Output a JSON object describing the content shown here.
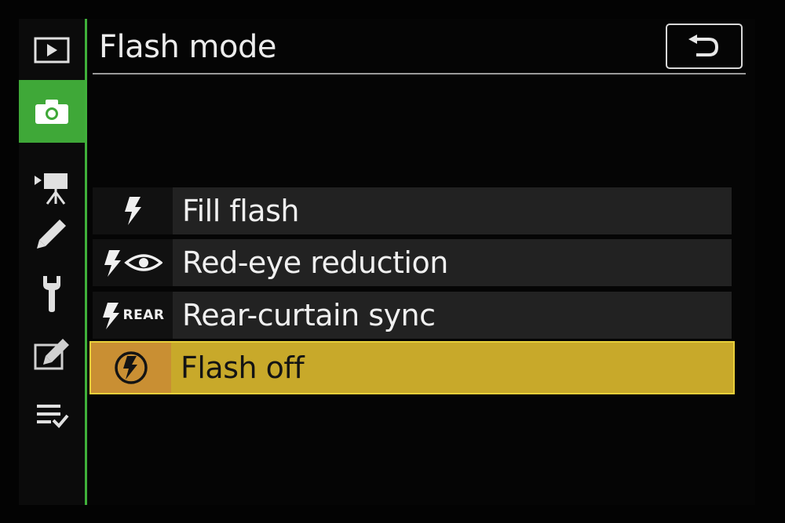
{
  "header": {
    "title": "Flash mode",
    "back_button_icon": "return-arrow-icon"
  },
  "sidebar": {
    "items": [
      {
        "icon": "playback-icon",
        "active": false
      },
      {
        "icon": "photo-shooting-camera-icon",
        "active": true
      },
      {
        "icon": "movie-shooting-icon",
        "active": false
      },
      {
        "icon": "custom-settings-pencil-icon",
        "active": false
      },
      {
        "icon": "setup-wrench-icon",
        "active": false
      },
      {
        "icon": "retouch-icon",
        "active": false
      },
      {
        "icon": "my-menu-icon",
        "active": false
      }
    ]
  },
  "menu": {
    "options": [
      {
        "label": "Fill flash",
        "icon": "fill-flash-icon",
        "selected": false
      },
      {
        "label": "Red-eye reduction",
        "icon": "red-eye-reduction-icon",
        "selected": false
      },
      {
        "label": "Rear-curtain sync",
        "icon": "rear-curtain-sync-icon",
        "icon_text": "REAR",
        "selected": false
      },
      {
        "label": "Flash off",
        "icon": "flash-off-icon",
        "selected": true
      }
    ]
  },
  "colors": {
    "accent_green": "#3fa838",
    "selected_highlight": "#c8a92a",
    "row_background": "#222222",
    "text": "#f0f0f0"
  }
}
